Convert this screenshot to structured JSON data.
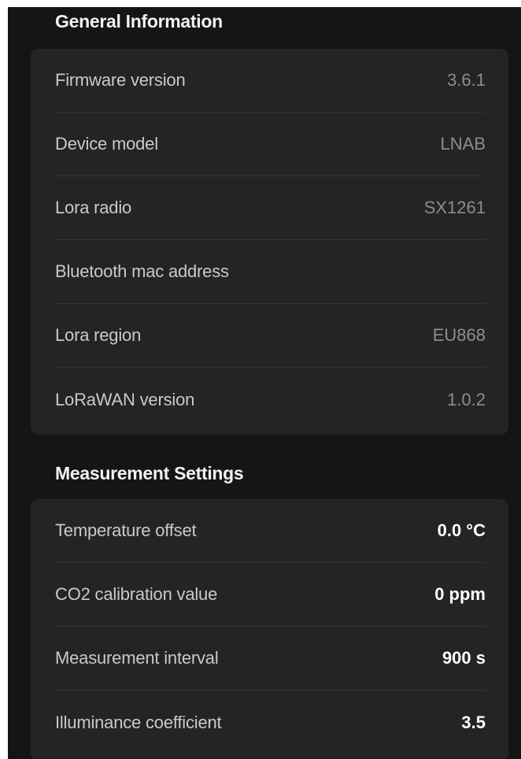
{
  "general_information": {
    "title": "General Information",
    "rows": [
      {
        "label": "Firmware version",
        "value": "3.6.1"
      },
      {
        "label": "Device model",
        "value": "LNAB"
      },
      {
        "label": "Lora radio",
        "value": "SX1261"
      },
      {
        "label": "Bluetooth mac address",
        "value": ""
      },
      {
        "label": "Lora region",
        "value": "EU868"
      },
      {
        "label": "LoRaWAN version",
        "value": "1.0.2"
      }
    ]
  },
  "measurement_settings": {
    "title": "Measurement Settings",
    "rows": [
      {
        "label": "Temperature offset",
        "value": "0.0 °C"
      },
      {
        "label": "CO2 calibration value",
        "value": "0 ppm"
      },
      {
        "label": "Measurement interval",
        "value": "900 s"
      },
      {
        "label": "Illuminance coefficient",
        "value": "3.5"
      }
    ]
  },
  "colors": {
    "background": "#151515",
    "card": "#242424",
    "divider": "#343434",
    "label_text": "#c9c9c9",
    "muted_value": "#8d8d8d",
    "strong_value": "#ffffff"
  }
}
